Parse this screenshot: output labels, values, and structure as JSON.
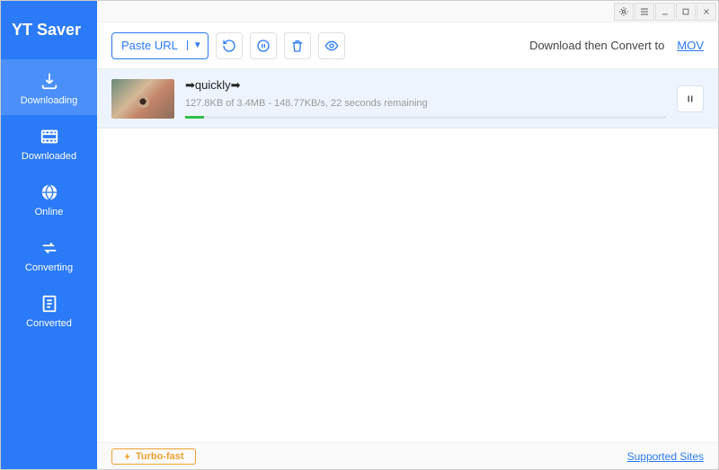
{
  "app": {
    "title": "YT Saver"
  },
  "sidebar": {
    "items": [
      {
        "label": "Downloading"
      },
      {
        "label": "Downloaded"
      },
      {
        "label": "Online"
      },
      {
        "label": "Converting"
      },
      {
        "label": "Converted"
      }
    ]
  },
  "toolbar": {
    "paste_label": "Paste URL",
    "convert_label": "Download then Convert to",
    "convert_format": "MOV"
  },
  "downloads": [
    {
      "title": "➡quickly➡",
      "status": "127.8KB of 3.4MB - 148.77KB/s, 22 seconds remaining",
      "progress_pct": 4
    }
  ],
  "footer": {
    "turbo_label": "Turbo-fast",
    "supported_label": "Supported Sites"
  }
}
